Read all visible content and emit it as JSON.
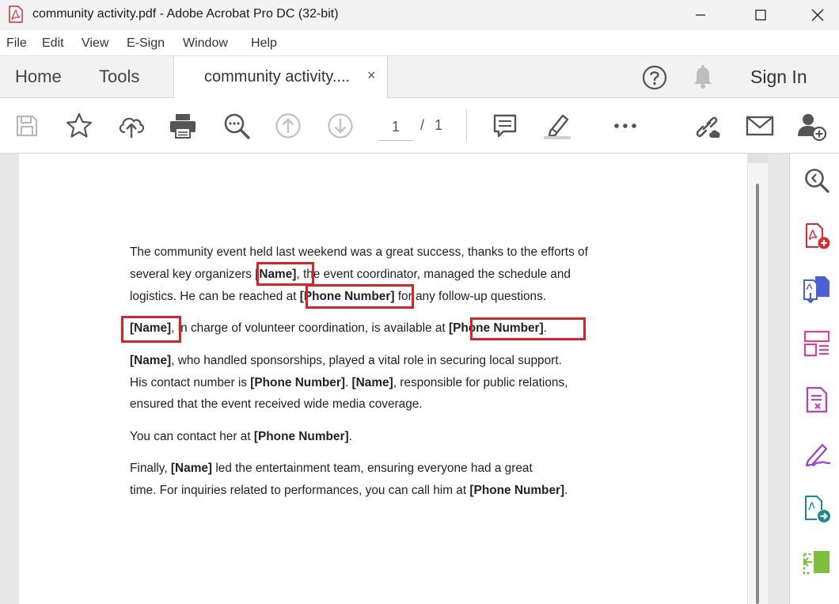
{
  "window": {
    "title": "community activity.pdf - Adobe Acrobat Pro DC (32-bit)"
  },
  "menu": {
    "items": [
      "File",
      "Edit",
      "View",
      "E-Sign",
      "Window",
      "Help"
    ]
  },
  "tabs": {
    "home": "Home",
    "tools": "Tools",
    "document": "community activity....",
    "close": "×",
    "signin": "Sign In"
  },
  "toolbar": {
    "current_page": "1",
    "separator": "/",
    "total_pages": "1",
    "more": "•••"
  },
  "document": {
    "p1_l1": "The community event held last weekend was a great success, thanks to the efforts of",
    "p1_l2_a": "several key organizers ",
    "p1_l2_b": "[Name]",
    "p1_l2_c": ", the event coordinator, managed the schedule and",
    "p1_l3_a": "logistics. He can be reached at ",
    "p1_l3_b": "[Phone Number]",
    "p1_l3_c": " for any follow-up questions.",
    "p2_a": "[Name]",
    "p2_b": ", in charge of volunteer coordination, is available at ",
    "p2_c": "[Phone Number]",
    "p2_d": ".",
    "p3_l1_a": "[Name]",
    "p3_l1_b": ", who handled sponsorships, played a vital role in securing local support.",
    "p3_l2_a": "His contact number is ",
    "p3_l2_b": "[Phone Number]",
    "p3_l2_c": ". ",
    "p3_l2_d": "[Name]",
    "p3_l2_e": ", responsible for public relations,",
    "p3_l3": "ensured that the event received wide media coverage.",
    "p4_a": "You can contact her at ",
    "p4_b": "[Phone Number]",
    "p4_c": ".",
    "p5_l1_a": "Finally, ",
    "p5_l1_b": "[Name]",
    "p5_l1_c": " led the entertainment team, ensuring everyone had a great",
    "p5_l2_a": "time. For inquiries related to performances, you can call him at ",
    "p5_l2_b": "[Phone Number]",
    "p5_l2_c": "."
  },
  "colors": {
    "highlight": "#d9232b",
    "acrobat_red": "#e2262f",
    "organize_blue": "#4a5fd8",
    "pink": "#d6458f",
    "purple": "#9b3fd0",
    "teal": "#1a8c8c",
    "green": "#7fbf3f"
  }
}
